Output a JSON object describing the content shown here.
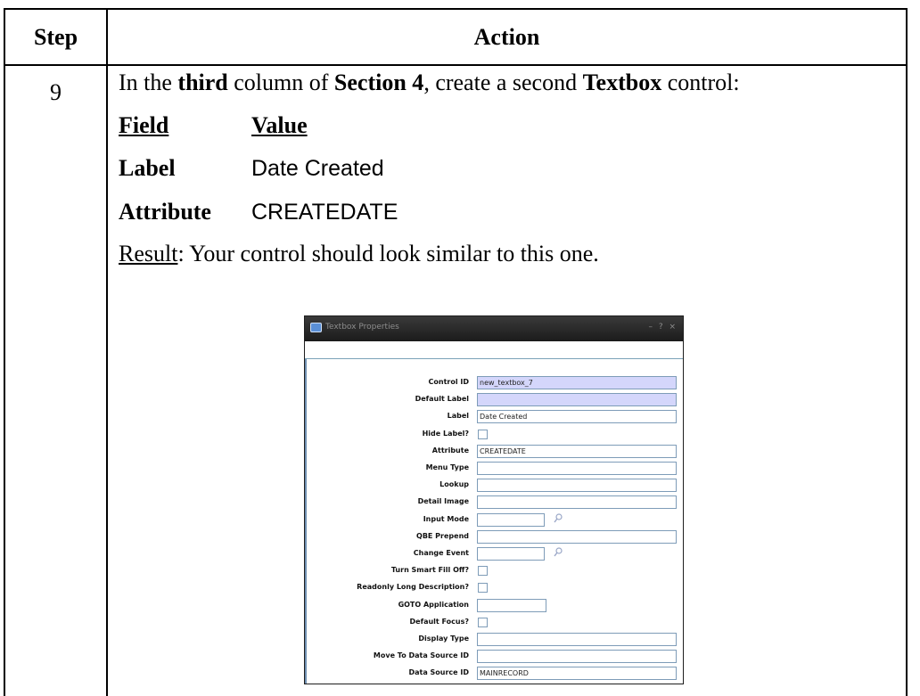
{
  "table": {
    "header_step": "Step",
    "header_action": "Action",
    "step_number": "9"
  },
  "instruction": {
    "part1": "In the ",
    "part2_bold": "third",
    "part3": " column of ",
    "part4_bold": "Section 4",
    "part5": ", create a second ",
    "part6_bold": "Textbox",
    "part7": " control:"
  },
  "field_table": {
    "col_field": "Field",
    "col_value": "Value",
    "rows": [
      {
        "field": "Label",
        "value": "Date Created"
      },
      {
        "field": "Attribute",
        "value": "CREATEDATE"
      }
    ]
  },
  "result": {
    "label": "Result",
    "text": ": Your control should look similar to this one."
  },
  "dialog": {
    "title": "Textbox Properties",
    "title_buttons": "– ? ×",
    "props": [
      {
        "label": "Control ID",
        "type": "text",
        "value": "new_textbox_7",
        "readonly": true
      },
      {
        "label": "Default Label",
        "type": "text",
        "value": "",
        "readonly": true
      },
      {
        "label": "Label",
        "type": "text",
        "value": "Date Created"
      },
      {
        "label": "Hide Label?",
        "type": "check"
      },
      {
        "label": "Attribute",
        "type": "text",
        "value": "CREATEDATE"
      },
      {
        "label": "Menu Type",
        "type": "text",
        "value": ""
      },
      {
        "label": "Lookup",
        "type": "text",
        "value": ""
      },
      {
        "label": "Detail Image",
        "type": "text",
        "value": ""
      },
      {
        "label": "Input Mode",
        "type": "lookup",
        "value": ""
      },
      {
        "label": "QBE Prepend",
        "type": "text",
        "value": ""
      },
      {
        "label": "Change Event",
        "type": "lookup",
        "value": ""
      },
      {
        "label": "Turn Smart Fill Off?",
        "type": "check"
      },
      {
        "label": "Readonly Long Description?",
        "type": "check"
      },
      {
        "label": "GOTO Application",
        "type": "medium",
        "value": ""
      },
      {
        "label": "Default Focus?",
        "type": "check"
      },
      {
        "label": "Display Type",
        "type": "text",
        "value": ""
      },
      {
        "label": "Move To Data Source ID",
        "type": "text",
        "value": ""
      },
      {
        "label": "Data Source ID",
        "type": "text",
        "value": "MAINRECORD"
      }
    ]
  }
}
